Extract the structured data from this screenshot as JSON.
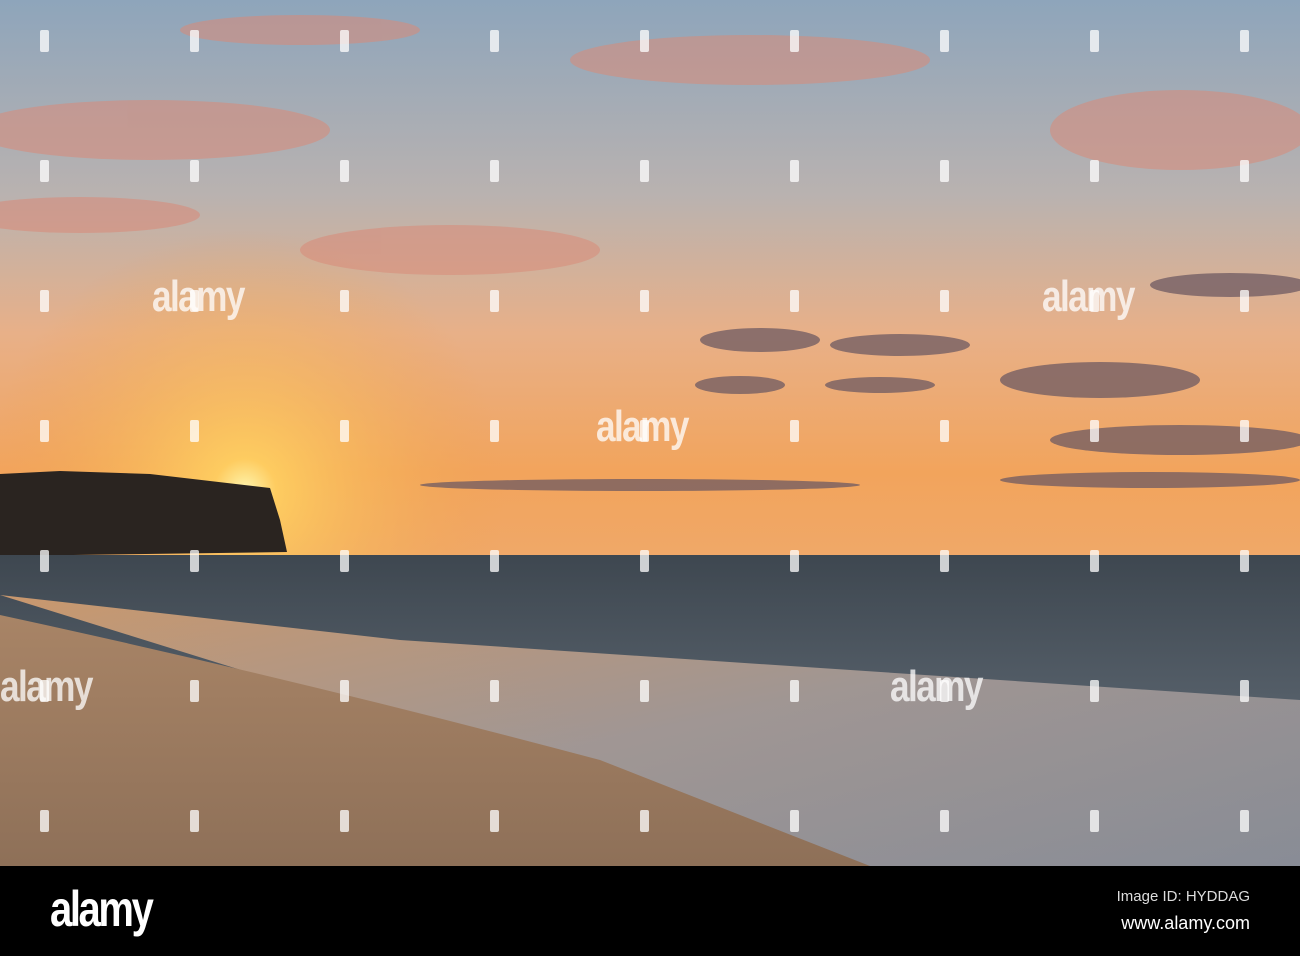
{
  "watermark": {
    "text": "alamy"
  },
  "footer": {
    "logo": "alamy",
    "image_id": "Image ID: HYDDAG",
    "url": "www.alamy.com"
  },
  "colors": {
    "sky_top": "#8ea5bb",
    "horizon": "#f2a45c",
    "sun": "#fff2a0",
    "sea": "#4b5661",
    "sand": "#9c7c62"
  }
}
